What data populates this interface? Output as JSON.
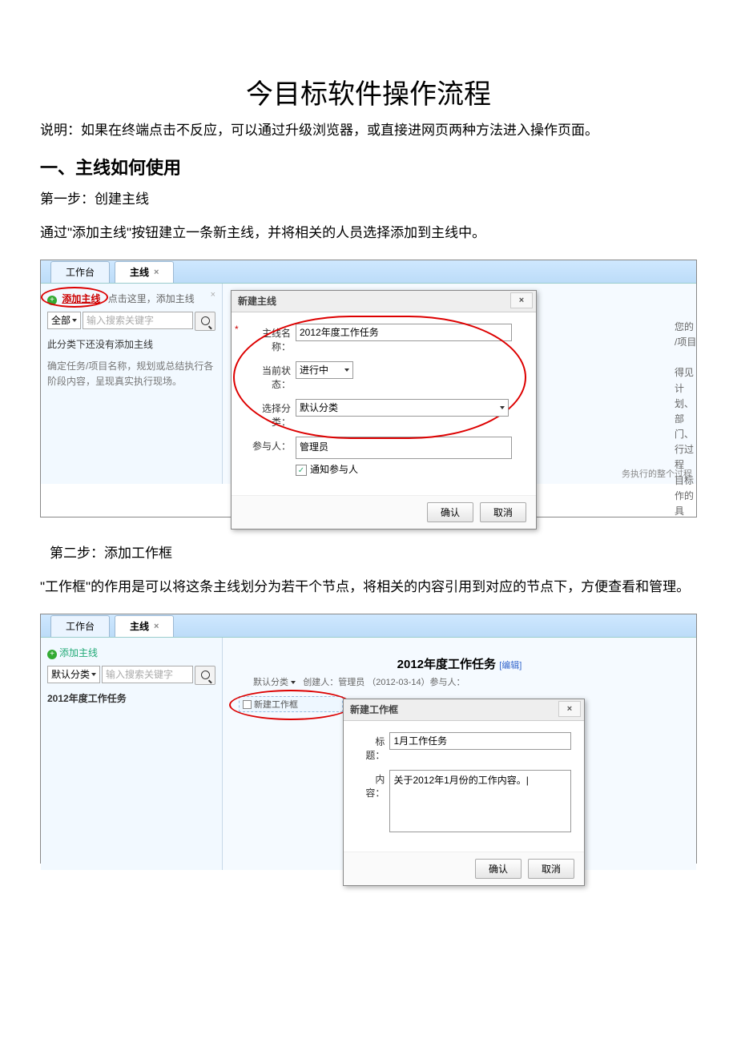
{
  "doc": {
    "title": "今目标软件操作流程",
    "intro": "说明：如果在终端点击不反应，可以通过升级浏览器，或直接进网页两种方法进入操作页面。",
    "h2_1": "一、主线如何使用",
    "step1": "第一步：创建主线",
    "para1": "通过\"添加主线\"按钮建立一条新主线，并将相关的人员选择添加到主线中。",
    "step2": "第二步：添加工作框",
    "para2": "\"工作框\"的作用是可以将这条主线划分为若干个节点，将相关的内容引用到对应的节点下，方便查看和管理。"
  },
  "s1": {
    "tabs": {
      "workbench": "工作台",
      "mainline": "主线"
    },
    "sidebar": {
      "add": "添加主线",
      "hint": "点击这里，添加主线",
      "cat": "全部",
      "search_ph": "输入搜索关键字",
      "empty": "此分类下还没有添加主线",
      "help": "确定任务/项目名称，规划或总结执行各阶段内容，呈现真实执行现场。"
    },
    "dlg": {
      "title": "新建主线",
      "f1": "主线名称：",
      "v1": "2012年度工作任务",
      "f2": "当前状态：",
      "v2": "进行中",
      "f3": "选择分类：",
      "v3": "默认分类",
      "f4": "参与人：",
      "v4": "管理员",
      "chk": "通知参与人",
      "ok": "确认",
      "cancel": "取消"
    },
    "side": [
      "您的",
      "/项目",
      "得见",
      "计划、",
      "部门、",
      "行过程",
      "目标",
      "作的具",
      "务执行的整个过程"
    ]
  },
  "s2": {
    "tabs": {
      "workbench": "工作台",
      "mainline": "主线"
    },
    "sidebar": {
      "add": "添加主线",
      "cat": "默认分类",
      "search_ph": "输入搜索关键字",
      "item": "2012年度工作任务"
    },
    "main": {
      "title": "2012年度工作任务",
      "edit": "[编辑]",
      "meta_cat": "默认分类",
      "meta": "创建人：管理员 （2012-03-14）参与人：",
      "newbox": "新建工作框"
    },
    "dlg": {
      "title": "新建工作框",
      "f1": "标题：",
      "v1": "1月工作任务",
      "f2": "内容：",
      "v2": "关于2012年1月份的工作内容。|",
      "ok": "确认",
      "cancel": "取消"
    }
  }
}
